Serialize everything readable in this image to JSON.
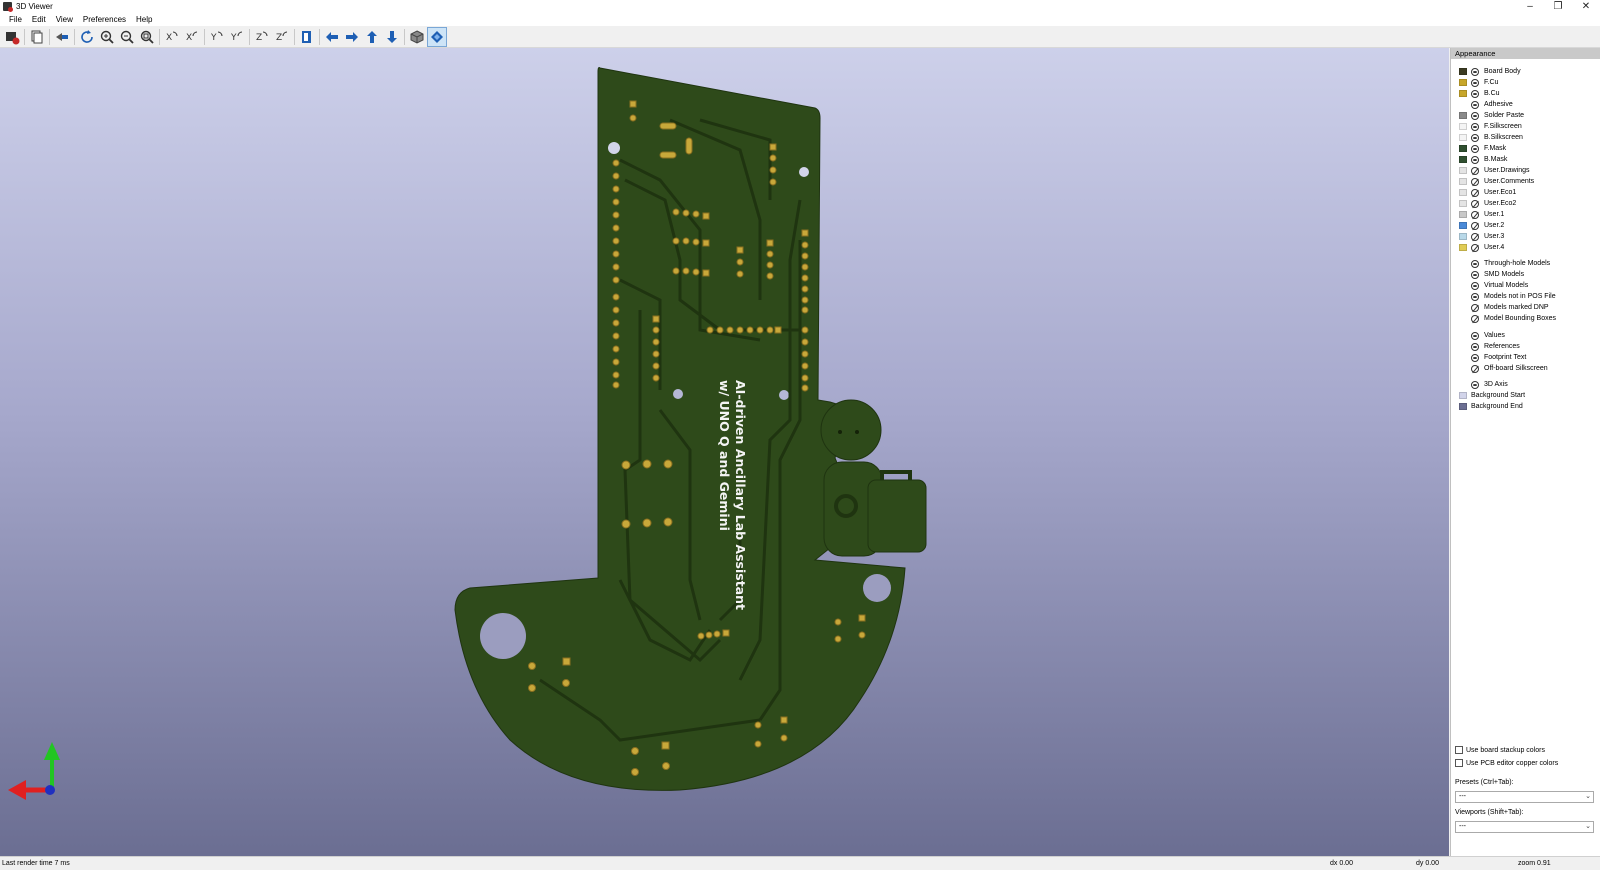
{
  "window": {
    "title": "3D Viewer",
    "controls": [
      "–",
      "❐",
      "✕"
    ]
  },
  "menu": [
    "File",
    "Edit",
    "View",
    "Preferences",
    "Help"
  ],
  "toolbar": {
    "buttons": [
      {
        "icon": "render-raytrace-icon"
      },
      {
        "icon": "copy-image-icon"
      },
      {
        "icon": "export-icon"
      },
      {
        "icon": "reload-icon"
      },
      {
        "icon": "zoom-in-icon"
      },
      {
        "icon": "zoom-out-icon"
      },
      {
        "icon": "zoom-fit-icon"
      },
      {
        "icon": "rotate-x-cw-icon"
      },
      {
        "icon": "rotate-x-ccw-icon"
      },
      {
        "icon": "rotate-y-cw-icon"
      },
      {
        "icon": "rotate-y-ccw-icon"
      },
      {
        "icon": "rotate-z-cw-icon"
      },
      {
        "icon": "rotate-z-ccw-icon"
      },
      {
        "icon": "flip-board-icon"
      },
      {
        "icon": "move-left-icon"
      },
      {
        "icon": "move-right-icon"
      },
      {
        "icon": "move-up-icon"
      },
      {
        "icon": "move-down-icon"
      },
      {
        "icon": "ortho-view-icon"
      },
      {
        "icon": "layers-manager-icon"
      }
    ]
  },
  "board": {
    "silkscreen_line1": "AI-driven Ancillary Lab Assistant",
    "silkscreen_line2": "w/ UNO Q and Gemini",
    "board_color": "#2e4a1a",
    "copper_color": "#c8a83a"
  },
  "appearance": {
    "title": "Appearance",
    "layers": [
      {
        "label": "Board Body",
        "swatch": "#3b3b22",
        "vis": "on"
      },
      {
        "label": "F.Cu",
        "swatch": "#c7a62a",
        "vis": "on"
      },
      {
        "label": "B.Cu",
        "swatch": "#c7a62a",
        "vis": "on"
      },
      {
        "label": "Adhesive",
        "swatch": "",
        "vis": "on"
      },
      {
        "label": "Solder Paste",
        "swatch": "#8a8a8a",
        "vis": "on"
      },
      {
        "label": "F.Silkscreen",
        "swatch": "#f4f4f4",
        "vis": "on"
      },
      {
        "label": "B.Silkscreen",
        "swatch": "#f4f4f4",
        "vis": "on"
      },
      {
        "label": "F.Mask",
        "swatch": "#2f4f2f",
        "vis": "on"
      },
      {
        "label": "B.Mask",
        "swatch": "#2f4f2f",
        "vis": "on"
      },
      {
        "label": "User.Drawings",
        "swatch": "#e4e4e4",
        "vis": "off"
      },
      {
        "label": "User.Comments",
        "swatch": "#e4e4e4",
        "vis": "off"
      },
      {
        "label": "User.Eco1",
        "swatch": "#e4e4e4",
        "vis": "off"
      },
      {
        "label": "User.Eco2",
        "swatch": "#e4e4e4",
        "vis": "off"
      },
      {
        "label": "User.1",
        "swatch": "#c8c8c8",
        "vis": "off"
      },
      {
        "label": "User.2",
        "swatch": "#4a8ad8",
        "vis": "off"
      },
      {
        "label": "User.3",
        "swatch": "#b9d9e9",
        "vis": "off"
      },
      {
        "label": "User.4",
        "swatch": "#e0cc55",
        "vis": "off"
      }
    ],
    "models": [
      {
        "label": "Through-hole Models",
        "vis": "on"
      },
      {
        "label": "SMD Models",
        "vis": "on"
      },
      {
        "label": "Virtual Models",
        "vis": "on"
      },
      {
        "label": "Models not in POS File",
        "vis": "on"
      },
      {
        "label": "Models marked DNP",
        "vis": "off"
      },
      {
        "label": "Model Bounding Boxes",
        "vis": "off"
      }
    ],
    "texts": [
      {
        "label": "Values",
        "vis": "on"
      },
      {
        "label": "References",
        "vis": "on"
      },
      {
        "label": "Footprint Text",
        "vis": "on"
      },
      {
        "label": "Off-board Silkscreen",
        "vis": "off"
      }
    ],
    "other": [
      {
        "label": "3D Axis",
        "swatch": "",
        "vis": "on"
      },
      {
        "label": "Background Start",
        "swatch": "#d2d4ea",
        "vis": ""
      },
      {
        "label": "Background End",
        "swatch": "#6b6e92",
        "vis": ""
      }
    ],
    "use_board_stackup": "Use board stackup colors",
    "use_pcb_copper": "Use PCB editor copper colors",
    "presets_label": "Presets (Ctrl+Tab):",
    "presets_value": "---",
    "viewports_label": "Viewports (Shift+Tab):",
    "viewports_value": "---"
  },
  "status": {
    "render_time": "Last render time 7 ms",
    "dx": "dx 0.00",
    "dy": "dy 0.00",
    "zoom": "zoom 0.91"
  }
}
